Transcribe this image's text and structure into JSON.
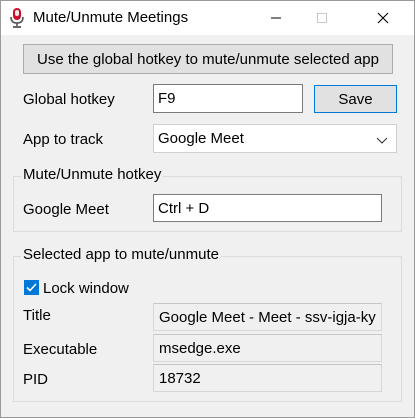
{
  "window": {
    "title": "Mute/Unmute Meetings",
    "app_icon": "microphone-icon",
    "controls": [
      "minimize-icon",
      "maximize-icon",
      "close-icon"
    ]
  },
  "top_button_label": "Use the global hotkey to mute/unmute selected app",
  "global_hotkey": {
    "label": "Global hotkey",
    "value": "F9",
    "save_label": "Save"
  },
  "app_to_track": {
    "label": "App to track",
    "selected": "Google Meet"
  },
  "mute_group": {
    "title": "Mute/Unmute hotkey",
    "label": "Google Meet",
    "value": "Ctrl + D"
  },
  "selected_group": {
    "title": "Selected app to mute/unmute",
    "lock_label": "Lock window",
    "lock_checked": true,
    "title_label": "Title",
    "title_value": "Google Meet - Meet - ssv-igja-ky",
    "exe_label": "Executable",
    "exe_value": "msedge.exe",
    "pid_label": "PID",
    "pid_value": "18732"
  },
  "colors": {
    "accent": "#0078d7",
    "background": "#f0f0f0",
    "icon_red": "#c8102e"
  }
}
